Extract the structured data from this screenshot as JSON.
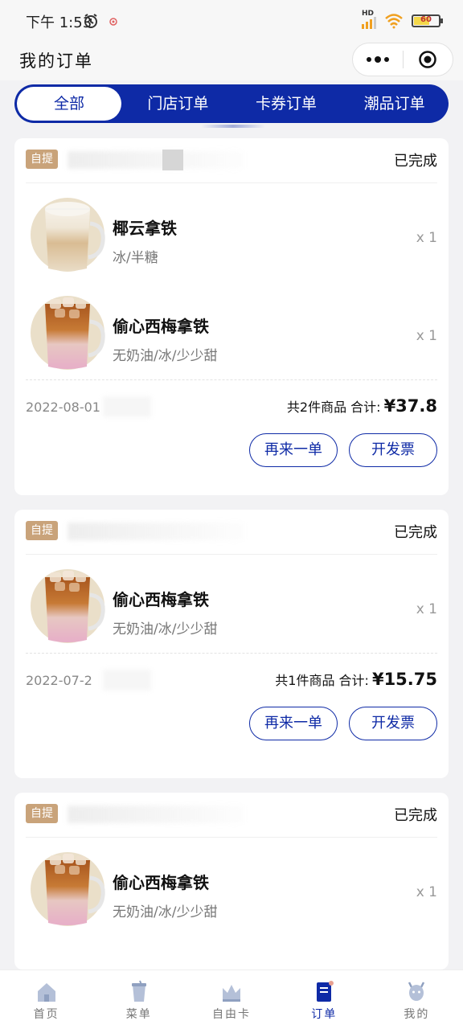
{
  "status_bar": {
    "time": "下午 1:53",
    "network": "HD",
    "battery": "60"
  },
  "header": {
    "title": "我的订单"
  },
  "tabs": [
    {
      "label": "全部",
      "active": true
    },
    {
      "label": "门店订单",
      "active": false
    },
    {
      "label": "卡券订单",
      "active": false
    },
    {
      "label": "潮品订单",
      "active": false
    }
  ],
  "orders": [
    {
      "badge": "自提",
      "status": "已完成",
      "items": [
        {
          "name": "椰云拿铁",
          "spec": "冰/半糖",
          "qty": "x 1",
          "image": "coconut-latte"
        },
        {
          "name": "偷心西梅拿铁",
          "spec": "无奶油/冰/少少甜",
          "qty": "x 1",
          "image": "plum-latte"
        }
      ],
      "date": "2022-08-01",
      "summary": "共2件商品 合计:",
      "price": "¥37.8",
      "reorder_label": "再来一单",
      "invoice_label": "开发票"
    },
    {
      "badge": "自提",
      "status": "已完成",
      "items": [
        {
          "name": "偷心西梅拿铁",
          "spec": "无奶油/冰/少少甜",
          "qty": "x 1",
          "image": "plum-latte"
        }
      ],
      "date": "2022-07-2",
      "summary": "共1件商品 合计:",
      "price": "¥15.75",
      "reorder_label": "再来一单",
      "invoice_label": "开发票"
    },
    {
      "badge": "自提",
      "status": "已完成",
      "items": [
        {
          "name": "偷心西梅拿铁",
          "spec": "无奶油/冰/少少甜",
          "qty": "x 1",
          "image": "plum-latte"
        }
      ]
    }
  ],
  "bottom_nav": [
    {
      "label": "首页",
      "icon": "home-icon",
      "active": false
    },
    {
      "label": "菜单",
      "icon": "cup-icon",
      "active": false
    },
    {
      "label": "自由卡",
      "icon": "crown-icon",
      "active": false
    },
    {
      "label": "订单",
      "icon": "order-icon",
      "active": true
    },
    {
      "label": "我的",
      "icon": "deer-icon",
      "active": false
    }
  ],
  "colors": {
    "brand": "#0e2aa6",
    "badge": "#c9a37a",
    "background": "#f2f2f4"
  }
}
